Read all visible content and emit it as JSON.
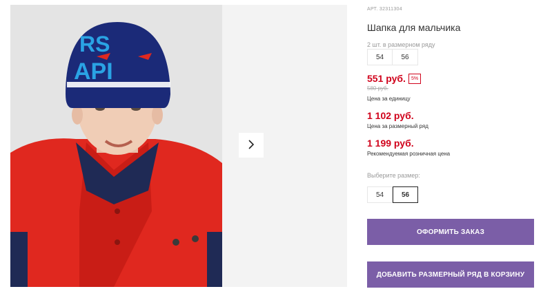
{
  "product": {
    "article": "АРТ. 32311304",
    "title": "Шапка для мальчика",
    "pack_label": "2 шт. в размерном ряду",
    "pack_sizes": [
      "54",
      "56"
    ],
    "price": "551 руб.",
    "discount": "5%",
    "old_price": "580 руб.",
    "unit_price_label": "Цена за единицу",
    "pack_price": "1 102 руб.",
    "pack_price_label": "Цена за размерный ряд",
    "retail_price": "1 199 руб.",
    "retail_price_label": "Рекомендуемая розничная цена",
    "size_select_label": "Выберите размер:",
    "size_options": [
      "54",
      "56"
    ],
    "selected_size": "56"
  },
  "actions": {
    "order": "ОФОРМИТЬ ЗАКАЗ",
    "add_pack": "ДОБАВИТЬ РАЗМЕРНЫЙ РЯД В КОРЗИНУ"
  },
  "colors": {
    "accent": "#7b5ea7",
    "price_red": "#d0021b"
  },
  "icons": {
    "next": "chevron-right-icon"
  }
}
